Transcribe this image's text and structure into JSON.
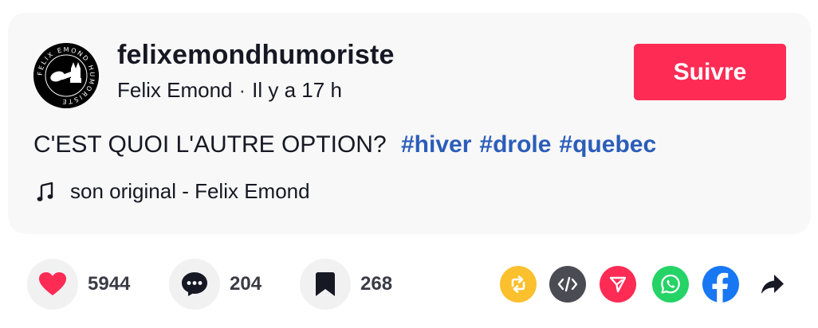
{
  "author": {
    "username": "felixemondhumoriste",
    "display_name": "Felix Emond",
    "separator": "·",
    "time_ago": "Il y a 17 h",
    "avatar_ring_text": "FELIX EMOND HUMORISTE"
  },
  "follow_button": {
    "label": "Suivre",
    "color": "#fe2c55"
  },
  "caption": {
    "text": "C'EST QUOI L'AUTRE OPTION?",
    "hashtags": [
      "#hiver",
      "#drole",
      "#quebec"
    ],
    "hashtag_color": "#2b5db9"
  },
  "music": {
    "icon": "music-note-icon",
    "label": "son original - Felix Emond"
  },
  "actions": {
    "likes": {
      "icon": "heart-icon",
      "count": "5944",
      "color": "#fe2c55"
    },
    "comments": {
      "icon": "comment-icon",
      "count": "204"
    },
    "saves": {
      "icon": "bookmark-icon",
      "count": "268"
    }
  },
  "share": [
    {
      "name": "repost-icon",
      "color": "#fbc02d"
    },
    {
      "name": "embed-icon",
      "color": "#4a4b53"
    },
    {
      "name": "send-to-friends-icon",
      "color": "#fe2c55"
    },
    {
      "name": "whatsapp-icon",
      "color": "#25d366"
    },
    {
      "name": "facebook-icon",
      "color": "#1877f2"
    },
    {
      "name": "share-arrow-icon",
      "color": "#161823"
    }
  ]
}
